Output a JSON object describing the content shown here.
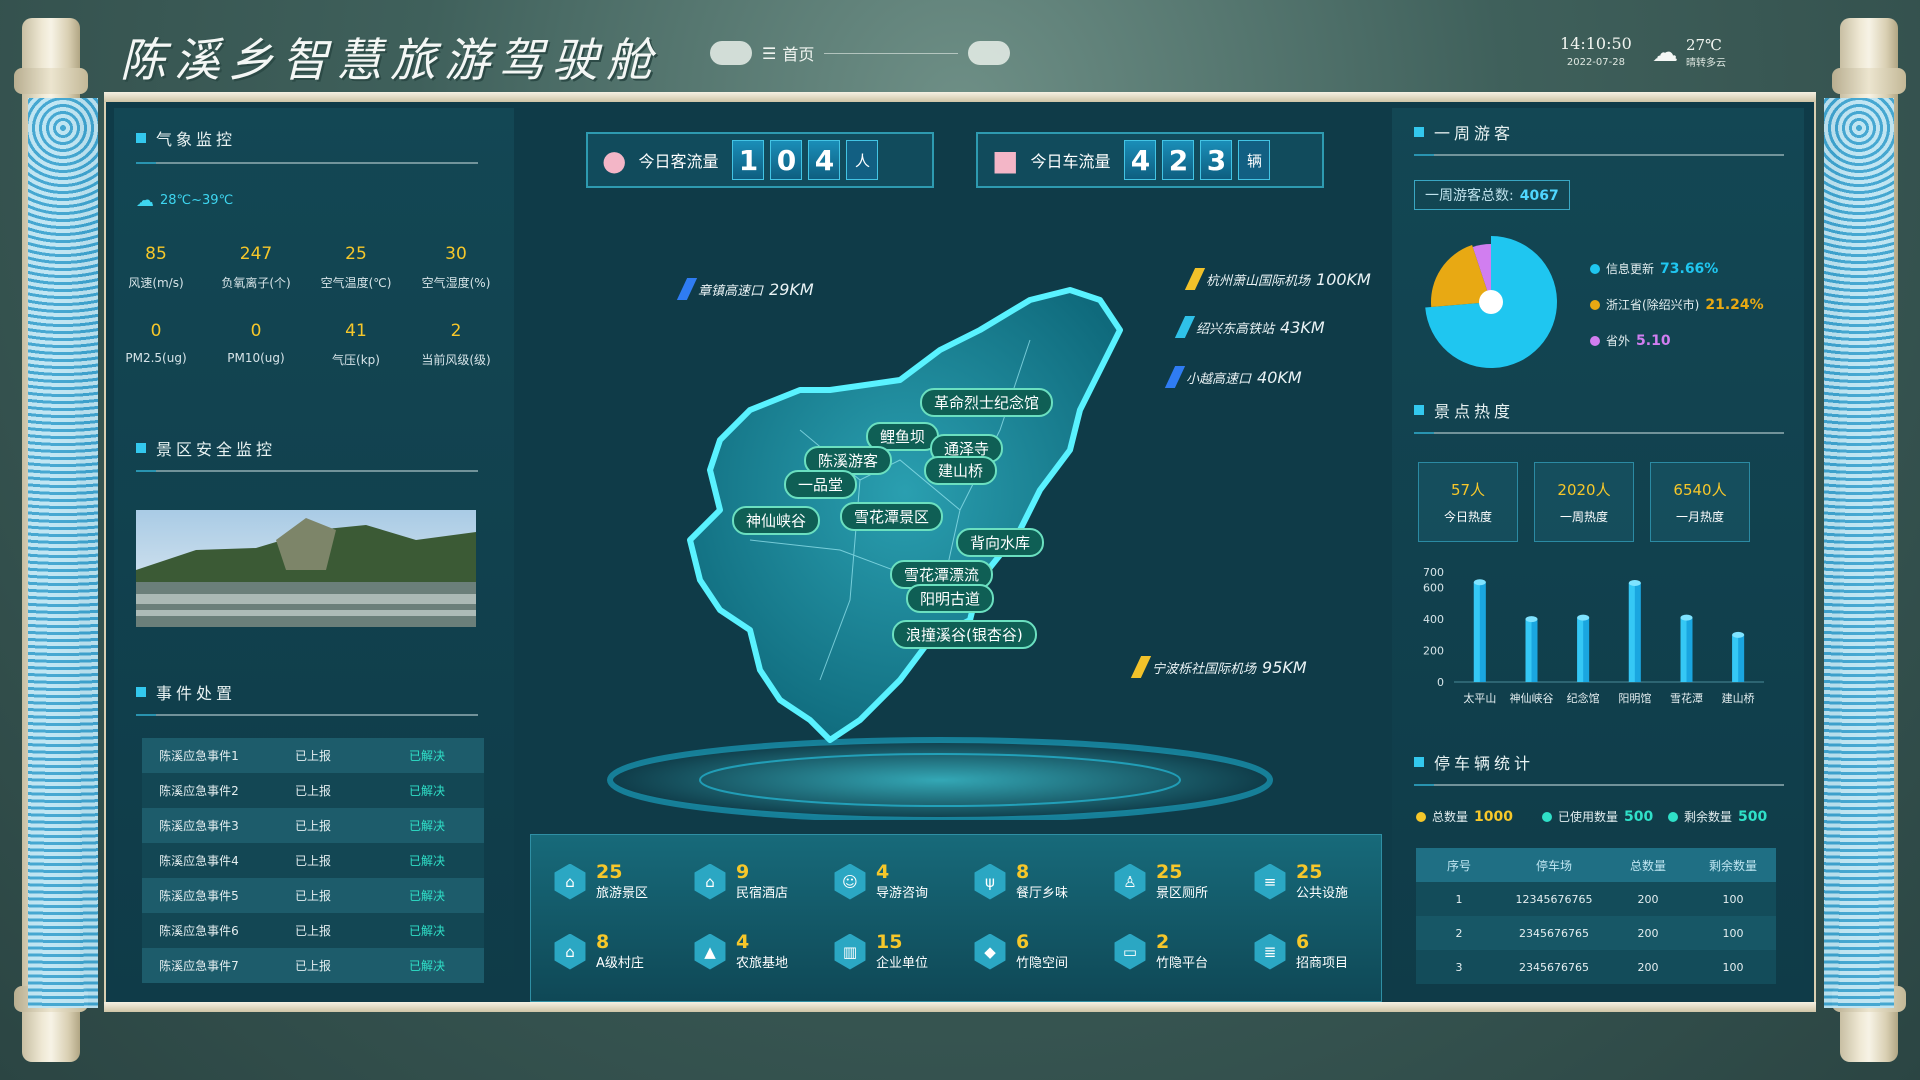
{
  "header": {
    "title": "陈溪乡智慧旅游驾驶舱",
    "nav_label": "首页",
    "time": "14:10:50",
    "date": "2022-07-28",
    "weather_temp": "27℃",
    "weather_desc": "晴转多云"
  },
  "climate": {
    "title": "气象监控",
    "temp_range": "28℃~39℃",
    "metrics": [
      {
        "value": "85",
        "label": "风速(m/s)"
      },
      {
        "value": "247",
        "label": "负氧离子(个)"
      },
      {
        "value": "25",
        "label": "空气温度(℃)"
      },
      {
        "value": "30",
        "label": "空气湿度(%)"
      },
      {
        "value": "0",
        "label": "PM2.5(ug)"
      },
      {
        "value": "0",
        "label": "PM10(ug)"
      },
      {
        "value": "41",
        "label": "气压(kp)"
      },
      {
        "value": "2",
        "label": "当前风级(级)"
      }
    ]
  },
  "safety": {
    "title": "景区安全监控"
  },
  "events": {
    "title": "事件处置",
    "rows": [
      {
        "name": "陈溪应急事件1",
        "report": "已上报",
        "status": "已解决"
      },
      {
        "name": "陈溪应急事件2",
        "report": "已上报",
        "status": "已解决"
      },
      {
        "name": "陈溪应急事件3",
        "report": "已上报",
        "status": "已解决"
      },
      {
        "name": "陈溪应急事件4",
        "report": "已上报",
        "status": "已解决"
      },
      {
        "name": "陈溪应急事件5",
        "report": "已上报",
        "status": "已解决"
      },
      {
        "name": "陈溪应急事件6",
        "report": "已上报",
        "status": "已解决"
      },
      {
        "name": "陈溪应急事件7",
        "report": "已上报",
        "status": "已解决"
      }
    ]
  },
  "stats": {
    "visitor_label": "今日客流量",
    "visitor_digits": [
      "1",
      "0",
      "4"
    ],
    "visitor_unit": "人",
    "vehicle_label": "今日车流量",
    "vehicle_digits": [
      "4",
      "2",
      "3"
    ],
    "vehicle_unit": "辆"
  },
  "distances": [
    {
      "name": "章镇高速口",
      "km": "29KM",
      "color": "#2f7cf3"
    },
    {
      "name": "杭州萧山国际机场",
      "km": "100KM",
      "color": "#f2c22a"
    },
    {
      "name": "绍兴东高铁站",
      "km": "43KM",
      "color": "#2fc1e8"
    },
    {
      "name": "小越高速口",
      "km": "40KM",
      "color": "#2f7cf3"
    },
    {
      "name": "宁波栎社国际机场",
      "km": "95KM",
      "color": "#f2c22a"
    }
  ],
  "map_labels": [
    "革命烈士纪念馆",
    "鲤鱼坝",
    "通泽寺",
    "陈溪游客",
    "建山桥",
    "一品堂",
    "神仙峡谷",
    "雪花潭景区",
    "背向水库",
    "雪花潭漂流",
    "阳明古道",
    "浪撞溪谷(银杏谷)"
  ],
  "facilities": [
    {
      "num": "25",
      "label": "旅游景区",
      "icon": "temple-icon"
    },
    {
      "num": "9",
      "label": "民宿酒店",
      "icon": "house-icon"
    },
    {
      "num": "4",
      "label": "导游咨询",
      "icon": "guide-icon"
    },
    {
      "num": "8",
      "label": "餐厅乡味",
      "icon": "fork-knife-icon"
    },
    {
      "num": "25",
      "label": "景区厕所",
      "icon": "toilet-icon"
    },
    {
      "num": "25",
      "label": "公共设施",
      "icon": "facility-icon"
    },
    {
      "num": "8",
      "label": "A级村庄",
      "icon": "village-icon"
    },
    {
      "num": "4",
      "label": "农旅基地",
      "icon": "mountain-icon"
    },
    {
      "num": "15",
      "label": "企业单位",
      "icon": "building-icon"
    },
    {
      "num": "6",
      "label": "竹隐空间",
      "icon": "cube-icon"
    },
    {
      "num": "2",
      "label": "竹隐平台",
      "icon": "monitor-icon"
    },
    {
      "num": "6",
      "label": "招商项目",
      "icon": "list-icon"
    }
  ],
  "weekly": {
    "title": "一周游客",
    "total_label": "一周游客总数:",
    "total": "4067",
    "legend": [
      {
        "label": "信息更新",
        "value": "73.66%",
        "color": "#1fc6f0"
      },
      {
        "label": "浙江省(除绍兴市)",
        "value": "21.24%",
        "color": "#e8a913"
      },
      {
        "label": "省外",
        "value": "5.10",
        "color": "#d17ef0"
      }
    ]
  },
  "heat": {
    "title": "景点热度",
    "cards": [
      {
        "value": "57人",
        "label": "今日热度"
      },
      {
        "value": "2020人",
        "label": "一周热度"
      },
      {
        "value": "6540人",
        "label": "一月热度"
      }
    ]
  },
  "chart_data": {
    "type": "bar",
    "categories": [
      "太平山",
      "神仙峡谷",
      "纪念馆",
      "阳明馆",
      "雪花潭",
      "建山桥"
    ],
    "values": [
      635,
      400,
      410,
      630,
      410,
      300
    ],
    "yticks": [
      "0",
      "200",
      "400",
      "600",
      "700"
    ],
    "ylim": [
      0,
      700
    ],
    "title": "",
    "xlabel": "",
    "ylabel": ""
  },
  "parking": {
    "title": "停车辆统计",
    "legend": [
      {
        "label": "总数量",
        "value": "1000",
        "color": "#f6c72a"
      },
      {
        "label": "已使用数量",
        "value": "500",
        "color": "#2fe0c8"
      },
      {
        "label": "剩余数量",
        "value": "500",
        "color": "#2fe0c8"
      }
    ],
    "headers": [
      "序号",
      "停车场",
      "总数量",
      "剩余数量"
    ],
    "rows": [
      [
        "1",
        "12345676765",
        "200",
        "100"
      ],
      [
        "2",
        "2345676765",
        "200",
        "100"
      ],
      [
        "3",
        "2345676765",
        "200",
        "100"
      ]
    ]
  }
}
